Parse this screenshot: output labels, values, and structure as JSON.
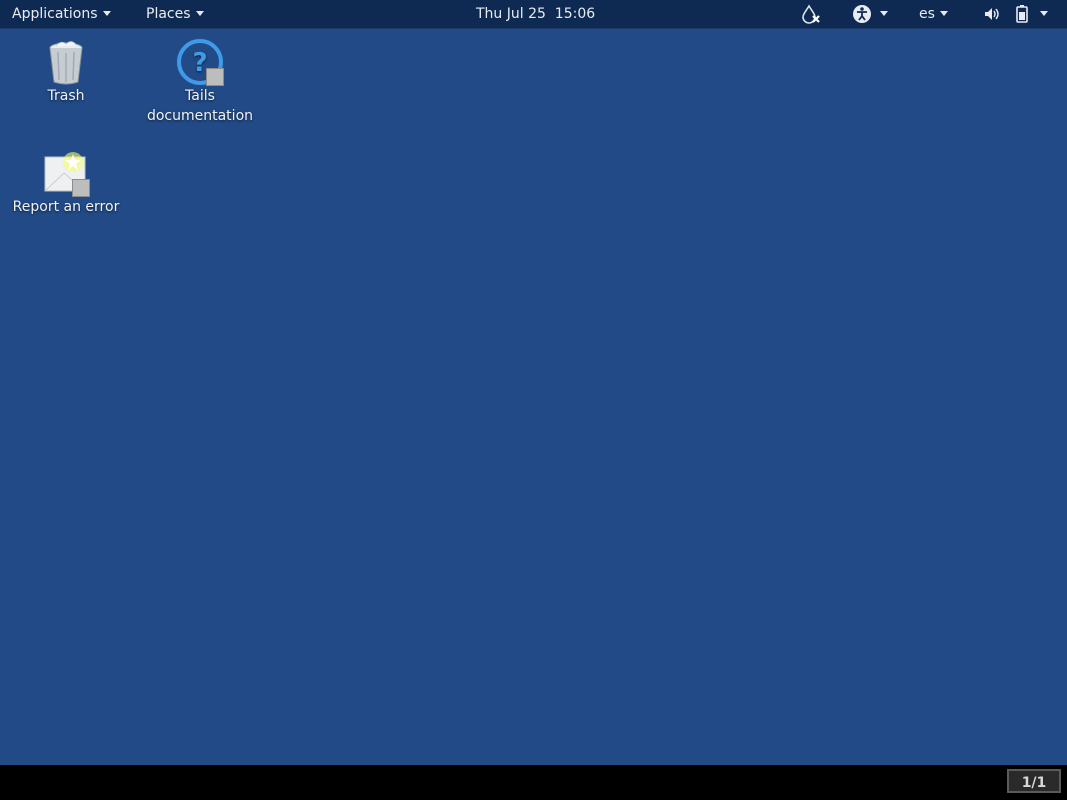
{
  "topbar": {
    "applications_label": "Applications",
    "places_label": "Places",
    "clock": "Thu Jul 25  15:06",
    "keyboard_layout": "es",
    "icons": [
      "tor-disconnected-icon",
      "accessibility-icon",
      "volume-icon",
      "battery-icon"
    ]
  },
  "desktop": {
    "icons": [
      {
        "name": "trash",
        "label": "Trash"
      },
      {
        "name": "tails-documentation",
        "label": "Tails documentation"
      },
      {
        "name": "report-an-error",
        "label": "Report an error"
      }
    ]
  },
  "bottombar": {
    "workspace_indicator": "1/1"
  }
}
